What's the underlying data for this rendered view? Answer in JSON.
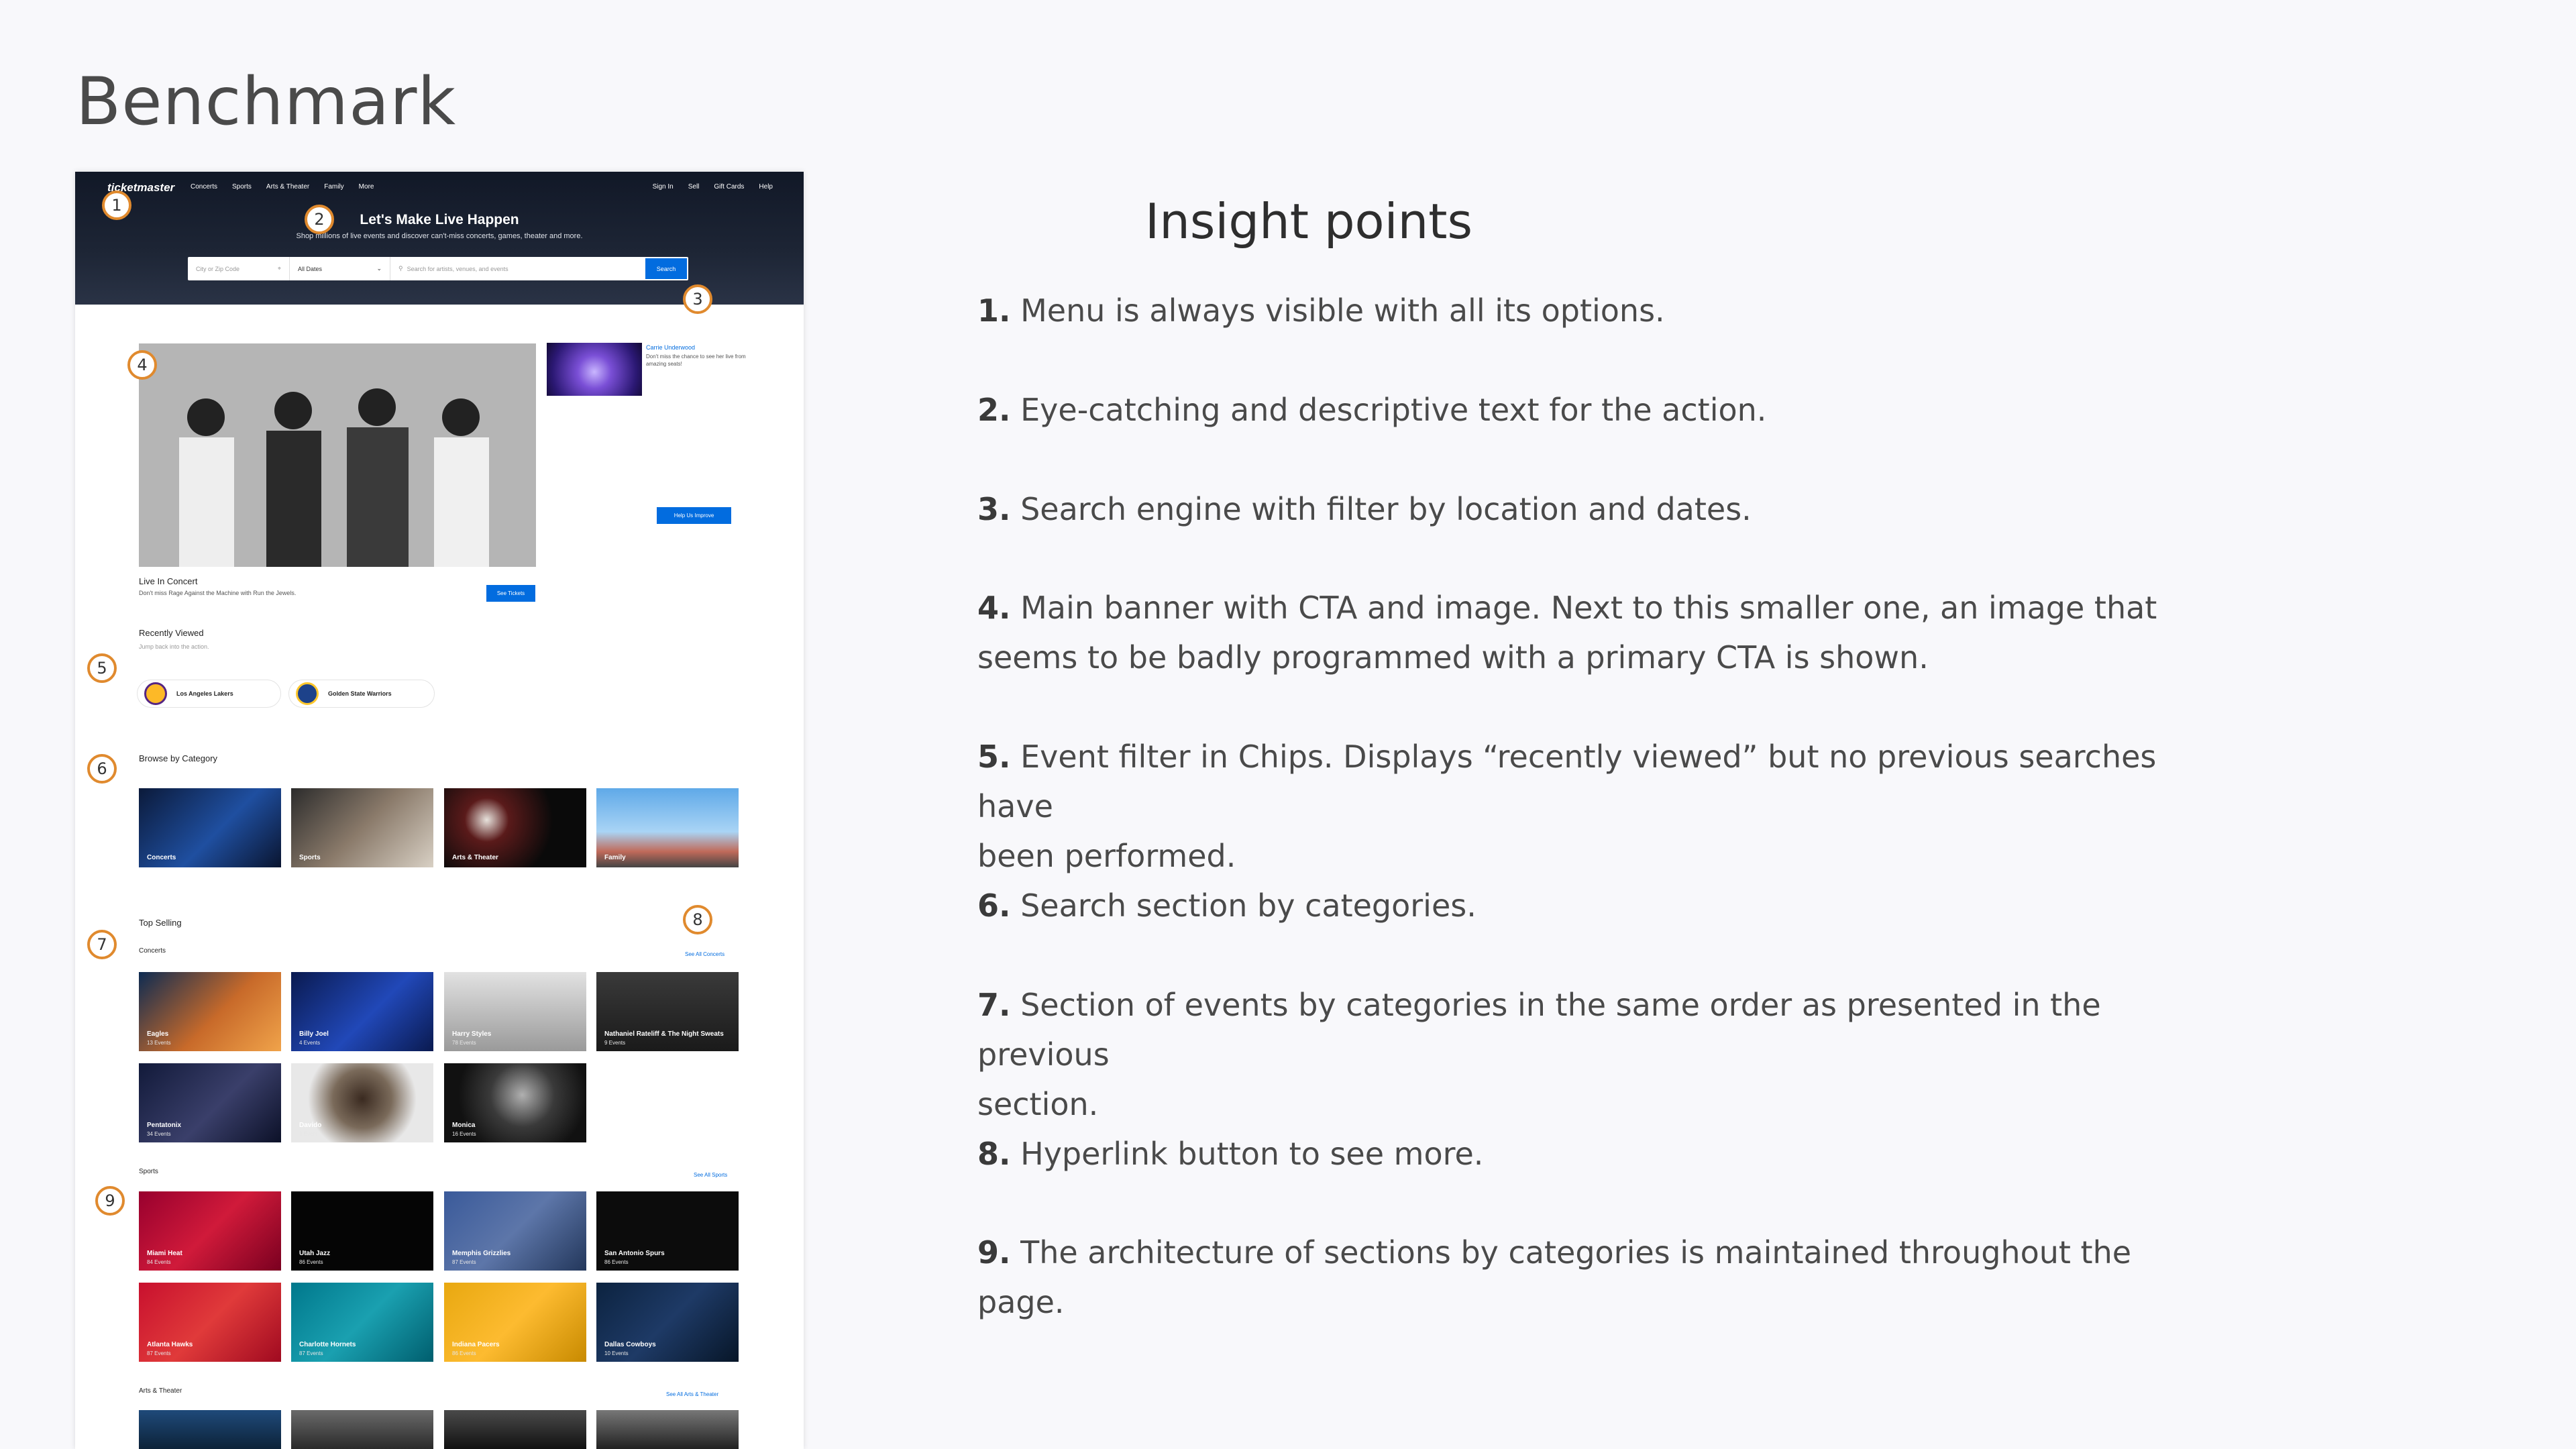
{
  "slide": {
    "title": "Benchmark"
  },
  "site": {
    "logo": "ticketmaster",
    "nav": [
      "Concerts",
      "Sports",
      "Arts & Theater",
      "Family",
      "More"
    ],
    "nav_right": [
      "Sign In",
      "Sell",
      "Gift Cards",
      "Help"
    ],
    "hero_title": "Let's Make Live Happen",
    "hero_sub": "Shop millions of live events and discover can't-miss concerts, games, theater and more.",
    "search": {
      "location_placeholder": "City or Zip Code",
      "dates_value": "All Dates",
      "query_placeholder": "Search for artists, venues, and events",
      "button": "Search"
    }
  },
  "banner": {
    "title": "Live In Concert",
    "subtitle": "Don't miss Rage Against the Machine with Run the Jewels.",
    "cta": "See Tickets",
    "side_link": "Carrie Underwood",
    "side_text": "Don't miss the chance to see her live from amazing seats!",
    "help_button": "Help Us Improve"
  },
  "recently_viewed": {
    "title": "Recently Viewed",
    "subtitle": "Jump back into the action.",
    "chips": [
      "Los Angeles Lakers",
      "Golden State Warriors"
    ]
  },
  "browse": {
    "title": "Browse by Category",
    "categories": [
      "Concerts",
      "Sports",
      "Arts & Theater",
      "Family"
    ]
  },
  "top_selling": {
    "title": "Top Selling",
    "concerts": {
      "title": "Concerts",
      "see_all": "See All Concerts",
      "items": [
        {
          "name": "Eagles",
          "events": "13 Events"
        },
        {
          "name": "Billy Joel",
          "events": "4 Events"
        },
        {
          "name": "Harry Styles",
          "events": "78 Events"
        },
        {
          "name": "Nathaniel Rateliff & The Night Sweats",
          "events": "9 Events"
        },
        {
          "name": "Pentatonix",
          "events": "34 Events"
        },
        {
          "name": "Davido",
          "events": "1 Event"
        },
        {
          "name": "Monica",
          "events": "16 Events"
        }
      ]
    },
    "sports": {
      "title": "Sports",
      "see_all": "See All Sports",
      "items": [
        {
          "name": "Miami Heat",
          "events": "84 Events"
        },
        {
          "name": "Utah Jazz",
          "events": "86 Events"
        },
        {
          "name": "Memphis Grizzlies",
          "events": "87 Events"
        },
        {
          "name": "San Antonio Spurs",
          "events": "86 Events"
        },
        {
          "name": "Atlanta Hawks",
          "events": "87 Events"
        },
        {
          "name": "Charlotte Hornets",
          "events": "87 Events"
        },
        {
          "name": "Indiana Pacers",
          "events": "86 Events"
        },
        {
          "name": "Dallas Cowboys",
          "events": "10 Events"
        }
      ]
    },
    "arts": {
      "title": "Arts & Theater",
      "see_all": "See All Arts & Theater"
    }
  },
  "insights": {
    "title": "Insight points",
    "items": [
      {
        "num": "1.",
        "text": "Menu is always visible with all its options."
      },
      {
        "num": "2.",
        "text": "Eye-catching and descriptive text for the action."
      },
      {
        "num": "3.",
        "text": "Search engine with filter by location and dates."
      },
      {
        "num": "4.",
        "line1": "Main banner with CTA and image. Next to this smaller one, an image that",
        "line2": "seems to be badly programmed with a primary CTA is shown."
      },
      {
        "num": "5.",
        "line1": "Event filter in Chips. Displays “recently viewed” but no previous searches have",
        "line2": "been performed."
      },
      {
        "num": "6.",
        "text": "Search section by categories."
      },
      {
        "num": "7.",
        "line1": "Section of events by categories in the same order as presented in the previous",
        "line2": "section."
      },
      {
        "num": "8.",
        "text": "Hyperlink button to see more."
      },
      {
        "num": "9.",
        "text": " The architecture of sections by categories is maintained throughout the page."
      }
    ]
  },
  "badges": [
    "1",
    "2",
    "3",
    "4",
    "5",
    "6",
    "7",
    "8",
    "9"
  ],
  "colors": {
    "accent": "#026cdf",
    "badge": "#e08a2e",
    "header": "#1d2535"
  }
}
